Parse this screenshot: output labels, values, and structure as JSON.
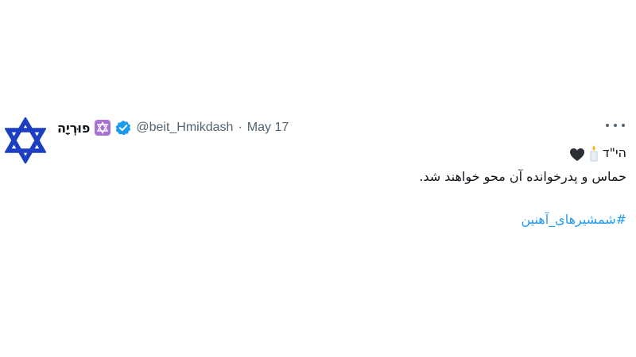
{
  "tweet": {
    "display_name": "פוּרְיָה",
    "badge_icon": "star-of-david-emoji-icon",
    "verified_icon": "verified-badge-icon",
    "handle": "@beit_Hmikdash",
    "separator": "·",
    "date": "May 17",
    "more_icon": "more-options-icon",
    "avatar_icon": "star-of-david-icon",
    "body": {
      "line1_text": "הי\"ד",
      "line1_icons": [
        "candle-icon",
        "black-heart-icon"
      ],
      "line2": "حماس و پدرخوانده آن محو خواهند شد.",
      "hashtag": "#شمشیرهای_آهنین"
    }
  },
  "colors": {
    "text_primary": "#0f1419",
    "text_secondary": "#536471",
    "link": "#1d9bf0",
    "verified": "#1d9bf0",
    "avatar_star": "#1c3fc1",
    "badge_bg": "#a971d6"
  }
}
